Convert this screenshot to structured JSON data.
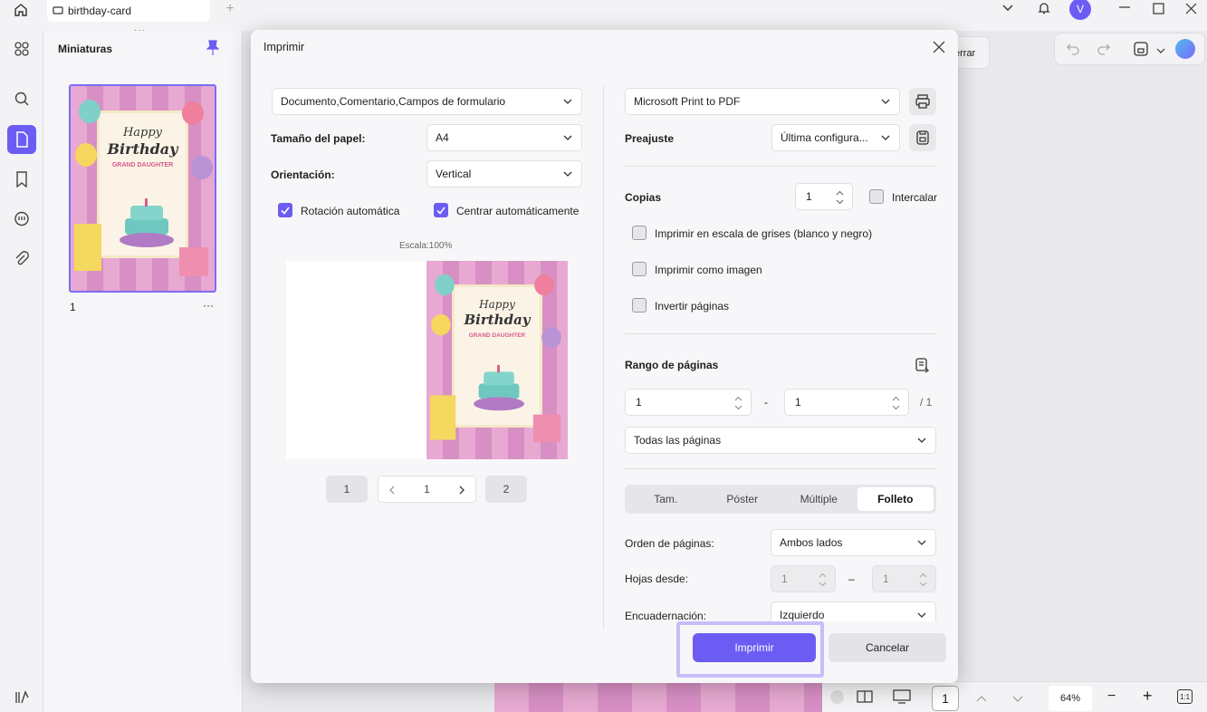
{
  "titlebar": {
    "tab_label": "birthday-card",
    "user_initial": "V"
  },
  "thumbnails": {
    "title": "Miniaturas",
    "page_label": "1",
    "more": "···"
  },
  "card": {
    "happy": "Happy",
    "birthday": "Birthday",
    "subtitle": "GRAND DAUGHTER"
  },
  "behind": {
    "cerrar_partial": "errar"
  },
  "dialog": {
    "title": "Imprimir",
    "content_select": "Documento,Comentario,Campos de formulario",
    "paper_size_label": "Tamaño del papel:",
    "paper_size_value": "A4",
    "orientation_label": "Orientación:",
    "orientation_value": "Vertical",
    "auto_rotate": "Rotación automática",
    "auto_center": "Centrar automáticamente",
    "scale": "Escala:100%",
    "pager": {
      "first": "1",
      "current": "1",
      "last": "2"
    },
    "printer": "Microsoft Print to PDF",
    "preset_label": "Preajuste",
    "preset_value": "Última configura...",
    "copies_label": "Copias",
    "copies_value": "1",
    "collate": "Intercalar",
    "grayscale": "Imprimir en escala de grises (blanco y negro)",
    "as_image": "Imprimir como imagen",
    "reverse": "Invertir páginas",
    "range_label": "Rango de páginas",
    "range_from": "1",
    "range_dash": "-",
    "range_to": "1",
    "range_total": "/ 1",
    "range_select": "Todas las páginas",
    "tabs": [
      "Tam.",
      "Póster",
      "Múltiple",
      "Folleto"
    ],
    "page_order_label": "Orden de páginas:",
    "page_order_value": "Ambos lados",
    "sheets_label": "Hojas desde:",
    "sheets_from": "1",
    "sheets_dash": "–",
    "sheets_to": "1",
    "binding_label": "Encuadernación:",
    "binding_value": "Izquierdo",
    "print": "Imprimir",
    "cancel": "Cancelar"
  },
  "bottombar": {
    "page": "1",
    "zoom": "64%"
  },
  "colors": {
    "accent": "#6d5cf3",
    "highlight": "#c5bff9"
  }
}
